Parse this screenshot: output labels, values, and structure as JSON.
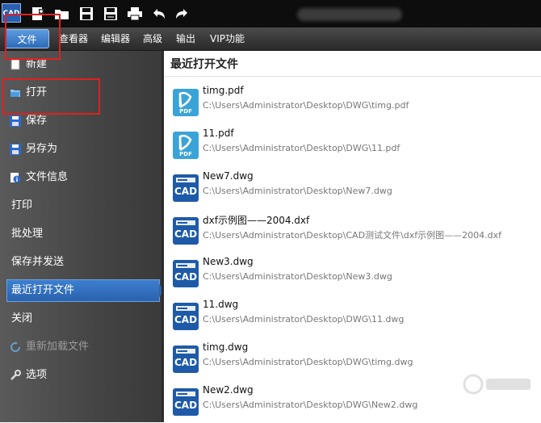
{
  "titlebar": {
    "app_icon_text": "CAD",
    "quick_access": [
      "new-icon",
      "folder-icon",
      "save-icon",
      "save-as-icon",
      "print-icon",
      "undo-icon",
      "redo-icon"
    ]
  },
  "menubar": {
    "items": [
      {
        "label": "文件"
      },
      {
        "label": "查看器"
      },
      {
        "label": "编辑器"
      },
      {
        "label": "高级"
      },
      {
        "label": "输出"
      },
      {
        "label": "VIP功能"
      }
    ]
  },
  "sidebar": {
    "items": [
      {
        "label": "新建",
        "icon": "new-icon"
      },
      {
        "label": "打开",
        "icon": "folder-open-icon"
      },
      {
        "label": "保存",
        "icon": "save-icon"
      },
      {
        "label": "另存为",
        "icon": "save-as-icon"
      },
      {
        "label": "文件信息",
        "icon": "info-icon"
      },
      {
        "label": "打印"
      },
      {
        "label": "批处理"
      },
      {
        "label": "保存并发送"
      },
      {
        "label": "最近打开文件",
        "active": true
      },
      {
        "label": "关闭"
      },
      {
        "label": "重新加载文件",
        "icon": "reload-icon",
        "disabled": true
      },
      {
        "label": "选项",
        "icon": "wrench-icon"
      }
    ]
  },
  "main": {
    "title": "最近打开文件",
    "files": [
      {
        "name": "timg.pdf",
        "path": "C:\\Users\\Administrator\\Desktop\\DWG\\timg.pdf",
        "type": "pdf"
      },
      {
        "name": "11.pdf",
        "path": "C:\\Users\\Administrator\\Desktop\\DWG\\11.pdf",
        "type": "pdf"
      },
      {
        "name": "New7.dwg",
        "path": "C:\\Users\\Administrator\\Desktop\\New7.dwg",
        "type": "cad"
      },
      {
        "name": "dxf示例图——2004.dxf",
        "path": "C:\\Users\\Administrator\\Desktop\\CAD测试文件\\dxf示例图——2004.dxf",
        "type": "cad"
      },
      {
        "name": "New3.dwg",
        "path": "C:\\Users\\Administrator\\Desktop\\New3.dwg",
        "type": "cad"
      },
      {
        "name": "11.dwg",
        "path": "C:\\Users\\Administrator\\Desktop\\DWG\\11.dwg",
        "type": "cad"
      },
      {
        "name": "timg.dwg",
        "path": "C:\\Users\\Administrator\\Desktop\\DWG\\timg.dwg",
        "type": "cad"
      },
      {
        "name": "New2.dwg",
        "path": "C:\\Users\\Administrator\\Desktop\\DWG\\New2.dwg",
        "type": "cad"
      }
    ],
    "pdf_icon_text": "PDF",
    "cad_icon_text": "CAD"
  },
  "colors": {
    "accent": "#2d6bb8",
    "annotation_red": "#e02020",
    "pdf_icon": "#3aa3d8",
    "cad_icon": "#1e5aa8"
  }
}
